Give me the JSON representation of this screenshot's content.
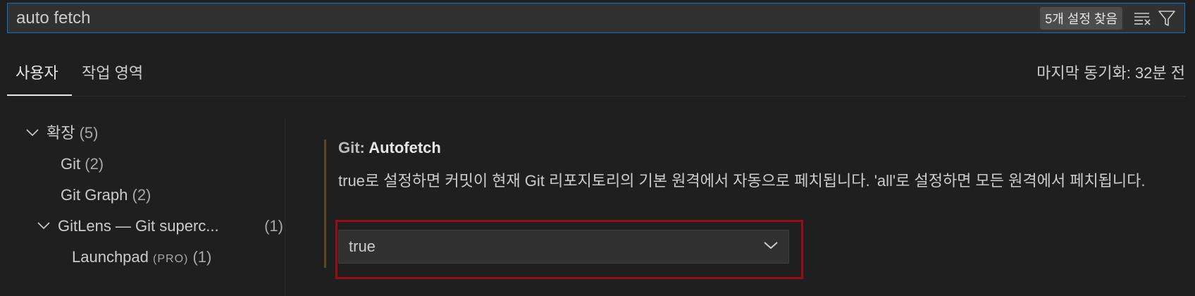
{
  "search": {
    "value": "auto fetch",
    "placeholder": "",
    "result_count": "5개 설정 찾음"
  },
  "icons": {
    "clear_filter": "clear-filter-icon",
    "filter": "filter-icon",
    "chevron_down": "chevron-down-icon"
  },
  "tabs": [
    {
      "label": "사용자",
      "active": true
    },
    {
      "label": "작업 영역",
      "active": false
    }
  ],
  "sync_status": "마지막 동기화: 32분 전",
  "toc": {
    "extensions": {
      "label": "확장",
      "count": "(5)"
    },
    "git": {
      "label": "Git",
      "count": "(2)"
    },
    "git_graph": {
      "label": "Git Graph",
      "count": "(2)"
    },
    "gitlens": {
      "label": "GitLens — Git superc...",
      "count": "(1)"
    },
    "launchpad": {
      "label": "Launchpad",
      "tag": "(PRO)",
      "count": "(1)"
    }
  },
  "setting": {
    "category": "Git: ",
    "name": "Autofetch",
    "description": "true로 설정하면 커밋이 현재 Git 리포지토리의 기본 원격에서 자동으로 페치됩니다. 'all'로 설정하면 모든 원격에서 페치됩니다.",
    "value": "true"
  },
  "colors": {
    "focus_border": "#0078d4",
    "highlight_border": "#9b0d14",
    "modified_bar": "#5c4a24",
    "background": "#1f1f1f"
  }
}
